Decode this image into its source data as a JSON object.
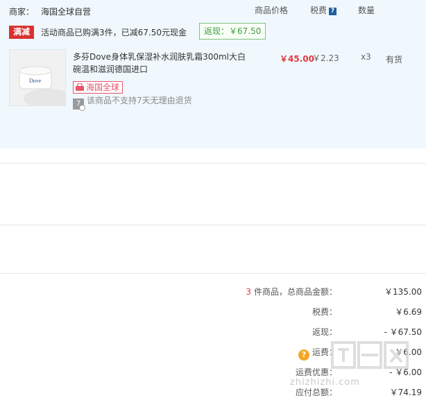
{
  "merchant": {
    "label": "商家：",
    "name": "海国全球自营"
  },
  "columns": {
    "price": "商品价格",
    "tax": "税费",
    "qty": "数量",
    "tax_help": "?"
  },
  "promo": {
    "tag": "满减",
    "text": "活动商品已购满3件，已减67.50元现金",
    "rebate": "返现：￥67.50"
  },
  "product": {
    "name": "多芬Dove身体乳保湿补水润肤乳霜300ml大白碗温和滋润德国进口",
    "thumb_brand": "Dove",
    "badge": "海国全球",
    "return_icon": "7",
    "no_return": "该商品不支持7天无理由退货",
    "price": "￥45.00",
    "tax": "￥2.23",
    "qty": "x3",
    "stock": "有货"
  },
  "summary": {
    "count": "3",
    "items_label": "件商品，总商品金额：",
    "items_value": "￥135.00",
    "tax_label": "税费：",
    "tax_value": "￥6.69",
    "rebate_label": "返现：",
    "rebate_value": "- ￥67.50",
    "shipping_label": "运费：",
    "shipping_value": "￥6.00",
    "ship_discount_label": "运费优惠：",
    "ship_discount_value": "- ￥6.00",
    "total_label": "应付总额：",
    "total_value": "￥74.19"
  },
  "watermark": "zhizhizhi.com",
  "icons": {
    "tax_help": "help-square-icon",
    "bag": "shopping-bag-icon",
    "return": "no-return-icon",
    "shipping": "question-circle-icon"
  },
  "colors": {
    "accent_red": "#e4393c",
    "promo_red": "#d8322f",
    "rebate_green": "#3f9a3f",
    "panel_bg": "#f0f8fd"
  }
}
